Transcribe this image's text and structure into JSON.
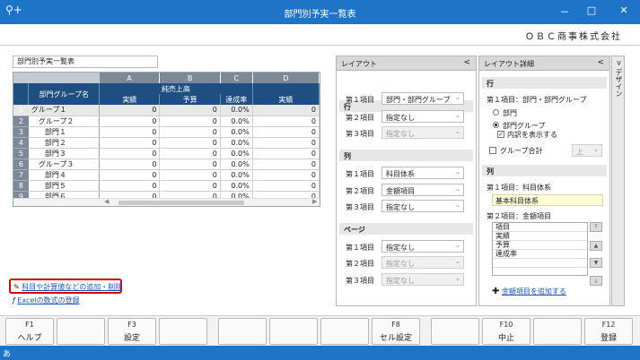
{
  "window": {
    "title": "部門別予実一覧表",
    "minimize": "－",
    "maximize": "□",
    "close": "✕",
    "company": "ＯＢＣ商事株式会社"
  },
  "report_title": "部門別予実一覧表",
  "grid": {
    "col_letters": [
      "A",
      "B",
      "C",
      "D"
    ],
    "name_header": "部門グループ名",
    "group_header": "純売上高",
    "sub_headers": [
      "実績",
      "予算",
      "達成率",
      "実績"
    ],
    "rows": [
      {
        "num": "1",
        "name": "グループ１",
        "a": "0",
        "b": "0",
        "c": "0.0%",
        "d": "0"
      },
      {
        "num": "2",
        "name": "グループ２",
        "a": "0",
        "b": "0",
        "c": "0.0%",
        "d": "0"
      },
      {
        "num": "3",
        "name": "部門１",
        "a": "0",
        "b": "0",
        "c": "0.0%",
        "d": "0"
      },
      {
        "num": "4",
        "name": "部門２",
        "a": "0",
        "b": "0",
        "c": "0.0%",
        "d": "0"
      },
      {
        "num": "5",
        "name": "部門３",
        "a": "0",
        "b": "0",
        "c": "0.0%",
        "d": "0"
      },
      {
        "num": "6",
        "name": "グループ３",
        "a": "0",
        "b": "0",
        "c": "0.0%",
        "d": "0"
      },
      {
        "num": "7",
        "name": "部門４",
        "a": "0",
        "b": "0",
        "c": "0.0%",
        "d": "0"
      },
      {
        "num": "8",
        "name": "部門５",
        "a": "0",
        "b": "0",
        "c": "0.0%",
        "d": "0"
      },
      {
        "num": "9",
        "name": "部門６",
        "a": "0",
        "b": "0",
        "c": "0.0%",
        "d": "0"
      }
    ]
  },
  "links": {
    "add_items": "科目や計算値などの追加・削除",
    "excel": "Excelの数式の登録"
  },
  "layout_panel": {
    "title": "レイアウト",
    "collapse": "<",
    "row_section": "行",
    "col_section": "列",
    "page_section": "ページ",
    "item1": "第１項目",
    "item2": "第２項目",
    "item3": "第３項目",
    "row_values": [
      "部門・部門グループ",
      "指定なし",
      "指定なし"
    ],
    "col_values": [
      "科目体系",
      "金額項目",
      "指定なし"
    ],
    "page_values": [
      "指定なし",
      "指定なし",
      "指定なし"
    ]
  },
  "detail_panel": {
    "title": "レイアウト詳細",
    "collapse": "<",
    "row_section": "行",
    "row_item1": "第１項目：部門・部門グループ",
    "radio_dept": "部門",
    "radio_group": "部門グループ",
    "check_inner": "内訳を表示する",
    "group_total": "グループ合計",
    "group_total_pos": "上",
    "col_section": "列",
    "col_item1": "第１項目：科目体系",
    "col_item1_value": "基本科目体系",
    "col_item2": "第２項目：金額項目",
    "list": [
      "項目",
      "実績",
      "予算",
      "達成率",
      "",
      ""
    ],
    "add_amount": "金額項目を追加する"
  },
  "design_tab": {
    "arrow": ">",
    "label": "デザイン"
  },
  "fkeys": [
    {
      "fn": "F1",
      "label": "ヘルプ"
    },
    {
      "fn": "",
      "label": ""
    },
    {
      "fn": "F3",
      "label": "設定"
    },
    {
      "fn": "",
      "label": ""
    },
    {
      "fn": "",
      "label": ""
    },
    {
      "fn": "",
      "label": ""
    },
    {
      "fn": "",
      "label": ""
    },
    {
      "fn": "F8",
      "label": "セル設定"
    },
    {
      "fn": "",
      "label": ""
    },
    {
      "fn": "F10",
      "label": "中止"
    },
    {
      "fn": "",
      "label": ""
    },
    {
      "fn": "F12",
      "label": "登録"
    }
  ],
  "colors": {
    "titlebar": "#1e74c6",
    "grid_header": "#1f4f80",
    "highlight": "#d40000",
    "link": "#1d56b8"
  }
}
